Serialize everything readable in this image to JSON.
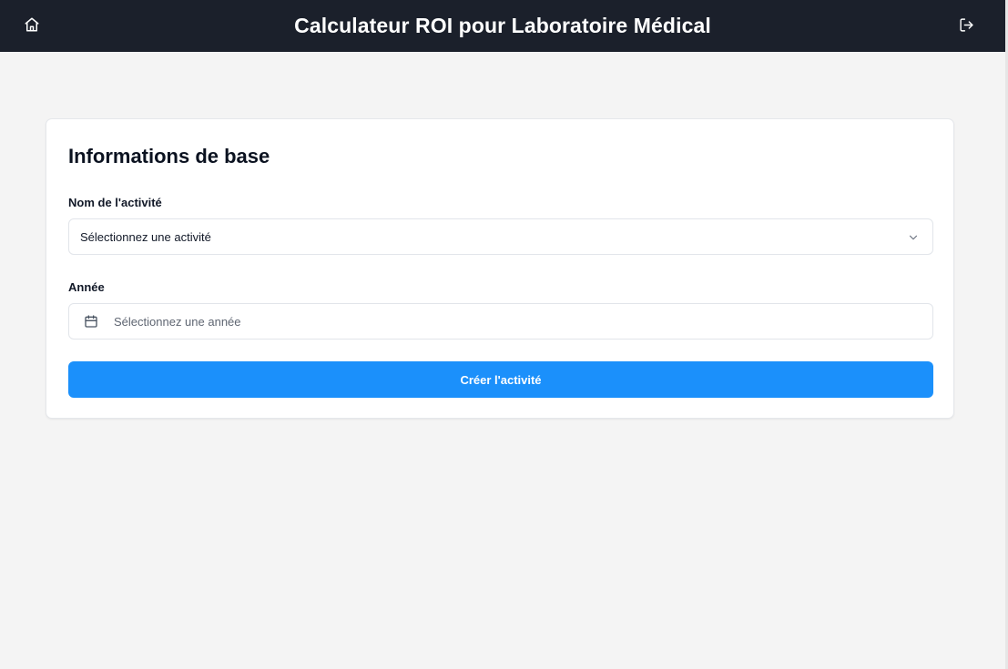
{
  "header": {
    "title": "Calculateur ROI pour Laboratoire Médical",
    "home_icon": "home-icon",
    "logout_icon": "logout-icon"
  },
  "form": {
    "title": "Informations de base",
    "activity": {
      "label": "Nom de l'activité",
      "value": "Sélectionnez une activité",
      "icon": "chevron-down-icon"
    },
    "year": {
      "label": "Année",
      "placeholder": "Sélectionnez une année",
      "icon": "calendar-icon"
    },
    "submit_label": "Créer l'activité"
  },
  "colors": {
    "header_bg": "#1b202b",
    "page_bg": "#f4f4f4",
    "primary": "#1b90fb"
  }
}
